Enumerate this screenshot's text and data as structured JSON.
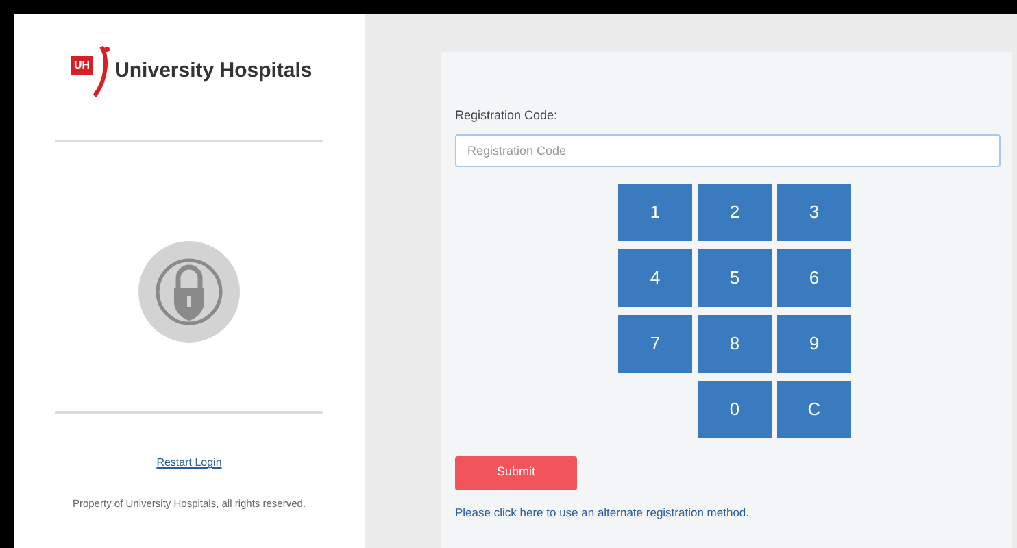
{
  "sidebar": {
    "logo_mark": "UH",
    "logo_text": "University Hospitals",
    "restart_link": "Restart Login",
    "footer": "Property of University Hospitals, all rights reserved."
  },
  "form": {
    "label": "Registration Code:",
    "placeholder": "Registration Code",
    "keypad": [
      [
        "1",
        "2",
        "3"
      ],
      [
        "4",
        "5",
        "6"
      ],
      [
        "7",
        "8",
        "9"
      ],
      [
        "0",
        "C"
      ]
    ],
    "submit": "Submit",
    "alternate_link": "Please click here to use an alternate registration method."
  }
}
